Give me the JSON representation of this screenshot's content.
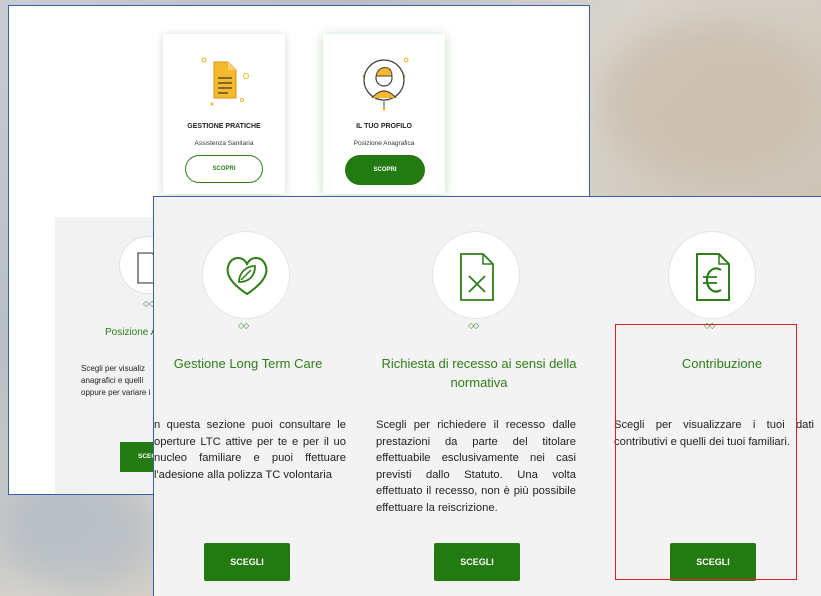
{
  "top_cards": [
    {
      "title": "GESTIONE PRATICHE",
      "subtitle": "Assistenza Sanitaria",
      "button": "SCOPRI"
    },
    {
      "title": "IL TUO PROFILO",
      "subtitle": "Posizione Anagrafica",
      "button": "SCOPRI"
    }
  ],
  "back_section": {
    "title": "Posizione A",
    "description_lines": [
      "Scegli per visualiz",
      "anagrafici e quelli",
      "oppure per variare i"
    ],
    "button": "SCEG"
  },
  "services": [
    {
      "icon": "heart-leaf-icon",
      "title": "Gestione Long Term Care",
      "description": "n questa sezione puoi consultare le operture LTC attive per te e per il uo nucleo familiare e puoi ffettuare l'adesione alla polizza TC volontaria",
      "button": "SCEGLI"
    },
    {
      "icon": "document-cross-icon",
      "title": "Richiesta di recesso ai sensi della normativa",
      "description": "Scegli per richiedere il recesso dalle prestazioni da parte del titolare effettuabile esclusivamente nei casi previsti dallo Statuto. Una volta effettuato il recesso, non è più possibile effettuare la reiscrizione.",
      "button": "SCEGLI"
    },
    {
      "icon": "document-euro-icon",
      "title": "Contribuzione",
      "description": "Scegli per visualizzare i tuoi dati contributivi e quelli dei tuoi familiari.",
      "button": "SCEGLI"
    }
  ],
  "colors": {
    "accent": "#237a10",
    "text_green": "#2e7d1a",
    "highlight": "#e02020",
    "window_border": "#3b5fa8"
  },
  "decoration": "◇◇"
}
